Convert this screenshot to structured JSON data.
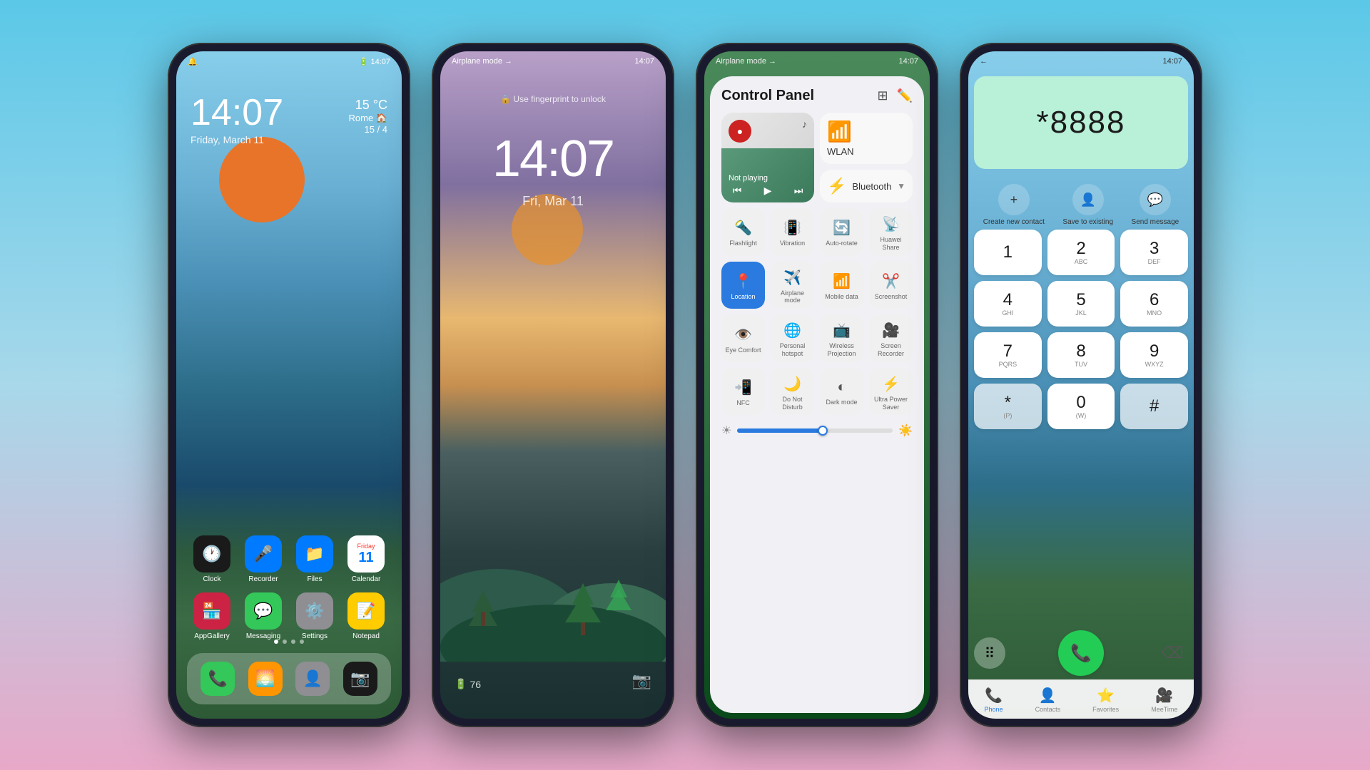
{
  "phone1": {
    "status_left": "🔔",
    "status_right": "🔋 14:07",
    "time": "14:07",
    "date": "Friday, March 11",
    "weather_temp": "15 °C",
    "weather_loc": "Rome 🏠",
    "weather_sub": "15 / 4",
    "apps_row1": [
      {
        "label": "Clock",
        "emoji": "🕐",
        "color": "#1a1a1a"
      },
      {
        "label": "Recorder",
        "emoji": "🎤",
        "color": "#007aff"
      },
      {
        "label": "Files",
        "emoji": "📁",
        "color": "#007aff"
      },
      {
        "label": "Calendar",
        "emoji": "📅",
        "color": "white"
      }
    ],
    "apps_row2": [
      {
        "label": "AppGallery",
        "emoji": "🏪",
        "color": "#cc2244"
      },
      {
        "label": "Messaging",
        "emoji": "💬",
        "color": "#34c759"
      },
      {
        "label": "Settings",
        "emoji": "⚙️",
        "color": "#8e8e93"
      },
      {
        "label": "Notepad",
        "emoji": "📝",
        "color": "#ffcc00"
      }
    ],
    "dock": [
      {
        "label": "Phone",
        "emoji": "📞",
        "color": "#34c759"
      },
      {
        "label": "Photos",
        "emoji": "🌅",
        "color": "#ff9500"
      },
      {
        "label": "Contacts",
        "emoji": "👤",
        "color": "#8e8e93"
      },
      {
        "label": "Camera",
        "emoji": "📷",
        "color": "#1a1a1a"
      }
    ]
  },
  "phone2": {
    "status_right": "14:07",
    "airplane": "Airplane mode →",
    "fingerprint_text": "🔒 Use fingerprint to unlock",
    "time": "14:07",
    "date": "Fri, Mar 11",
    "battery_pct": "76",
    "battery_icon": "🔋"
  },
  "phone3": {
    "status_right": "14:07",
    "airplane": "Airplane mode →",
    "title": "Control Panel",
    "not_playing": "Not playing",
    "wlan_label": "WLAN",
    "bluetooth_label": "Bluetooth",
    "controls": [
      {
        "label": "Flashlight",
        "icon": "🔦"
      },
      {
        "label": "Vibration",
        "icon": "📳"
      },
      {
        "label": "Auto-rotate",
        "icon": "🔄"
      },
      {
        "label": "Huawei Share",
        "icon": "📡"
      },
      {
        "label": "Location",
        "icon": "📍"
      },
      {
        "label": "Airplane mode",
        "icon": "✈️"
      },
      {
        "label": "Mobile data",
        "icon": "📶"
      },
      {
        "label": "Screenshot",
        "icon": "✂️"
      },
      {
        "label": "Eye Comfort",
        "icon": "👁️"
      },
      {
        "label": "Personal hotspot",
        "icon": "📶"
      },
      {
        "label": "Wireless Projection",
        "icon": "📺"
      },
      {
        "label": "Screen Recorder",
        "icon": "🎥"
      },
      {
        "label": "NFC",
        "icon": "📲"
      },
      {
        "label": "Do Not Disturb",
        "icon": "🌙"
      },
      {
        "label": "Dark mode",
        "icon": "◐"
      },
      {
        "label": "Ultra Power Saver",
        "icon": "⚡"
      }
    ]
  },
  "phone4": {
    "status_right": "14:07",
    "number": "*8888",
    "actions": [
      {
        "label": "Create new contact",
        "icon": "+"
      },
      {
        "label": "Save to existing",
        "icon": "👤"
      },
      {
        "label": "Send message",
        "icon": "💬"
      }
    ],
    "keys": [
      {
        "digit": "1",
        "letter": ""
      },
      {
        "digit": "2",
        "letter": "ABC"
      },
      {
        "digit": "3",
        "letter": "DEF"
      },
      {
        "digit": "4",
        "letter": "GHI"
      },
      {
        "digit": "5",
        "letter": "JKL"
      },
      {
        "digit": "6",
        "letter": "MNO"
      },
      {
        "digit": "7",
        "letter": "PQRS"
      },
      {
        "digit": "8",
        "letter": "TUV"
      },
      {
        "digit": "9",
        "letter": "WXYZ"
      },
      {
        "digit": "*",
        "letter": "(P)"
      },
      {
        "digit": "0",
        "letter": "(W)"
      },
      {
        "digit": "#",
        "letter": ""
      }
    ],
    "tabs": [
      {
        "label": "Phone",
        "icon": "📞",
        "active": true
      },
      {
        "label": "Contacts",
        "icon": "👤"
      },
      {
        "label": "Favorites",
        "icon": "⭐"
      },
      {
        "label": "MeeTime",
        "icon": "🎥"
      }
    ]
  }
}
